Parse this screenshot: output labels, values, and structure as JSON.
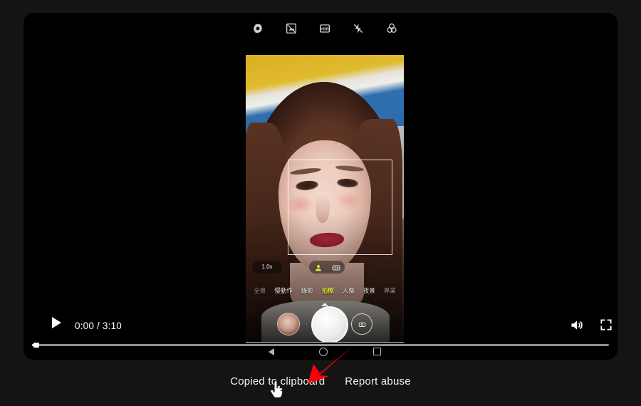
{
  "theme": {
    "page_bg": "#141414",
    "player_bg": "#000000",
    "accent_text": "#f1f1f1",
    "mode_active_color": "#d8e337",
    "annotation_arrow_color": "#fb0007"
  },
  "player": {
    "play_button_label": "Play",
    "time_display": "0:00 / 3:10",
    "current_time": "0:00",
    "duration": "3:10",
    "progress_percent": 0,
    "controls": [
      {
        "name": "play-button",
        "icon": "play-icon"
      },
      {
        "name": "volume-button",
        "icon": "volume-icon"
      },
      {
        "name": "fullscreen-button",
        "icon": "fullscreen-icon"
      },
      {
        "name": "more-options-button",
        "icon": "kebab-menu-icon"
      }
    ]
  },
  "video": {
    "description": "Phone screen recording of a camera app in selfie mode",
    "camera_toolbar": [
      {
        "name": "settings-icon",
        "label": "Settings"
      },
      {
        "name": "timer-icon",
        "label": "Timer"
      },
      {
        "name": "hdr-icon",
        "label": "HDR"
      },
      {
        "name": "flash-off-icon",
        "label": "Flash off"
      },
      {
        "name": "filters-icon",
        "label": "Filters"
      }
    ],
    "zoom_level": "1.0x",
    "quick_chips": [
      {
        "name": "portrait-beauty-icon",
        "label": "Beauty"
      },
      {
        "name": "grid-effects-icon",
        "label": "Effects"
      }
    ],
    "modes": [
      {
        "label": "全景",
        "active": false,
        "dim": true
      },
      {
        "label": "慢動作",
        "active": false,
        "dim": false
      },
      {
        "label": "錄影",
        "active": false,
        "dim": false
      },
      {
        "label": "拍照",
        "active": true,
        "dim": false
      },
      {
        "label": "人像",
        "active": false,
        "dim": false
      },
      {
        "label": "夜景",
        "active": false,
        "dim": false
      },
      {
        "label": "專業",
        "active": false,
        "dim": true
      }
    ],
    "shutter": {
      "gallery_thumb_label": "Last photo",
      "shutter_label": "Shutter",
      "flip_label": "Switch camera"
    },
    "android_nav": [
      {
        "name": "nav-back-button",
        "label": "Back"
      },
      {
        "name": "nav-home-button",
        "label": "Home"
      },
      {
        "name": "nav-recents-button",
        "label": "Recents"
      }
    ]
  },
  "footer": {
    "links": [
      {
        "name": "copied-to-clipboard-link",
        "label": "Copied to clipboard"
      },
      {
        "name": "report-abuse-link",
        "label": "Report abuse"
      }
    ]
  },
  "annotations": {
    "arrow": {
      "name": "red-arrow-annotation",
      "points_to": "Copied to clipboard"
    },
    "cursor": {
      "name": "mouse-cursor",
      "type": "pointer-hand"
    }
  }
}
